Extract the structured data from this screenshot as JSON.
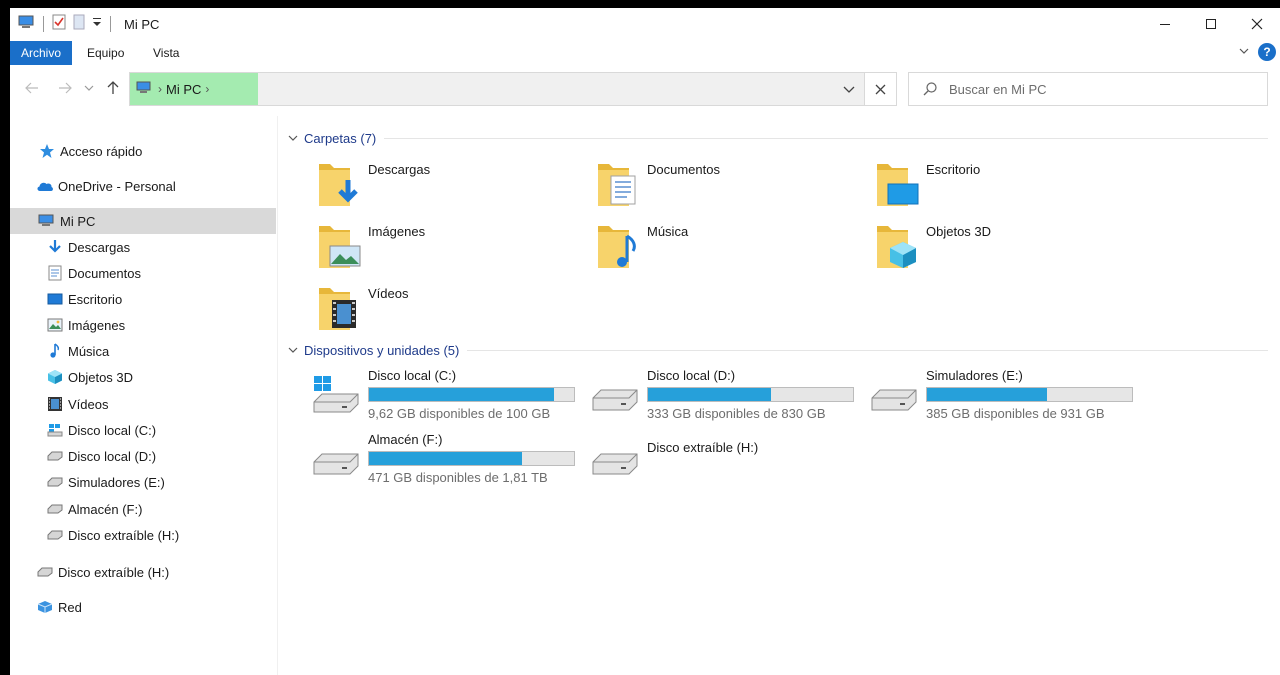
{
  "window": {
    "title": "Mi PC"
  },
  "ribbon": {
    "tabs": [
      "Archivo",
      "Equipo",
      "Vista"
    ],
    "help_label": "?"
  },
  "address": {
    "crumb": "Mi PC"
  },
  "search": {
    "placeholder": "Buscar en Mi PC"
  },
  "sidebar": {
    "items": [
      {
        "label": "Acceso rápido",
        "icon": "star-icon"
      },
      {
        "label": "OneDrive - Personal",
        "icon": "cloud-icon"
      },
      {
        "label": "Mi PC",
        "icon": "computer-icon",
        "selected": true
      },
      {
        "label": "Descargas",
        "icon": "download-icon"
      },
      {
        "label": "Documentos",
        "icon": "document-icon"
      },
      {
        "label": "Escritorio",
        "icon": "desktop-icon"
      },
      {
        "label": "Imágenes",
        "icon": "picture-icon"
      },
      {
        "label": "Música",
        "icon": "music-icon"
      },
      {
        "label": "Objetos 3D",
        "icon": "cube-icon"
      },
      {
        "label": "Vídeos",
        "icon": "film-icon"
      },
      {
        "label": "Disco local (C:)",
        "icon": "windows-drive-icon"
      },
      {
        "label": "Disco local (D:)",
        "icon": "drive-icon"
      },
      {
        "label": "Simuladores (E:)",
        "icon": "drive-icon"
      },
      {
        "label": "Almacén (F:)",
        "icon": "drive-icon"
      },
      {
        "label": "Disco extraíble (H:)",
        "icon": "drive-icon"
      },
      {
        "label": "Disco extraíble (H:)",
        "icon": "drive-icon"
      },
      {
        "label": "Red",
        "icon": "network-icon"
      }
    ]
  },
  "folders_group": {
    "label": "Carpetas (7)"
  },
  "folders": [
    {
      "name": "Descargas",
      "overlay": "download"
    },
    {
      "name": "Documentos",
      "overlay": "document"
    },
    {
      "name": "Escritorio",
      "overlay": "desktop"
    },
    {
      "name": "Imágenes",
      "overlay": "picture"
    },
    {
      "name": "Música",
      "overlay": "music"
    },
    {
      "name": "Objetos 3D",
      "overlay": "cube"
    },
    {
      "name": "Vídeos",
      "overlay": "film"
    }
  ],
  "devices_group": {
    "label": "Dispositivos y unidades (5)"
  },
  "drives": [
    {
      "name": "Disco local (C:)",
      "free": "9,62 GB disponibles de 100 GB",
      "used_fraction": 0.904,
      "windows": true
    },
    {
      "name": "Disco local (D:)",
      "free": "333 GB disponibles de 830 GB",
      "used_fraction": 0.599
    },
    {
      "name": "Simuladores (E:)",
      "free": "385 GB disponibles de 931 GB",
      "used_fraction": 0.586
    },
    {
      "name": "Almacén (F:)",
      "free": "471 GB disponibles de 1,81 TB",
      "used_fraction": 0.746
    },
    {
      "name": "Disco extraíble (H:)",
      "free": "",
      "used_fraction": null
    }
  ],
  "colors": {
    "accent": "#1a6fc9",
    "bar_fill": "#26a0da",
    "selection": "#d9d9d9",
    "crumb_highlight": "#a4ebb0",
    "group_header": "#1e3a8a"
  }
}
